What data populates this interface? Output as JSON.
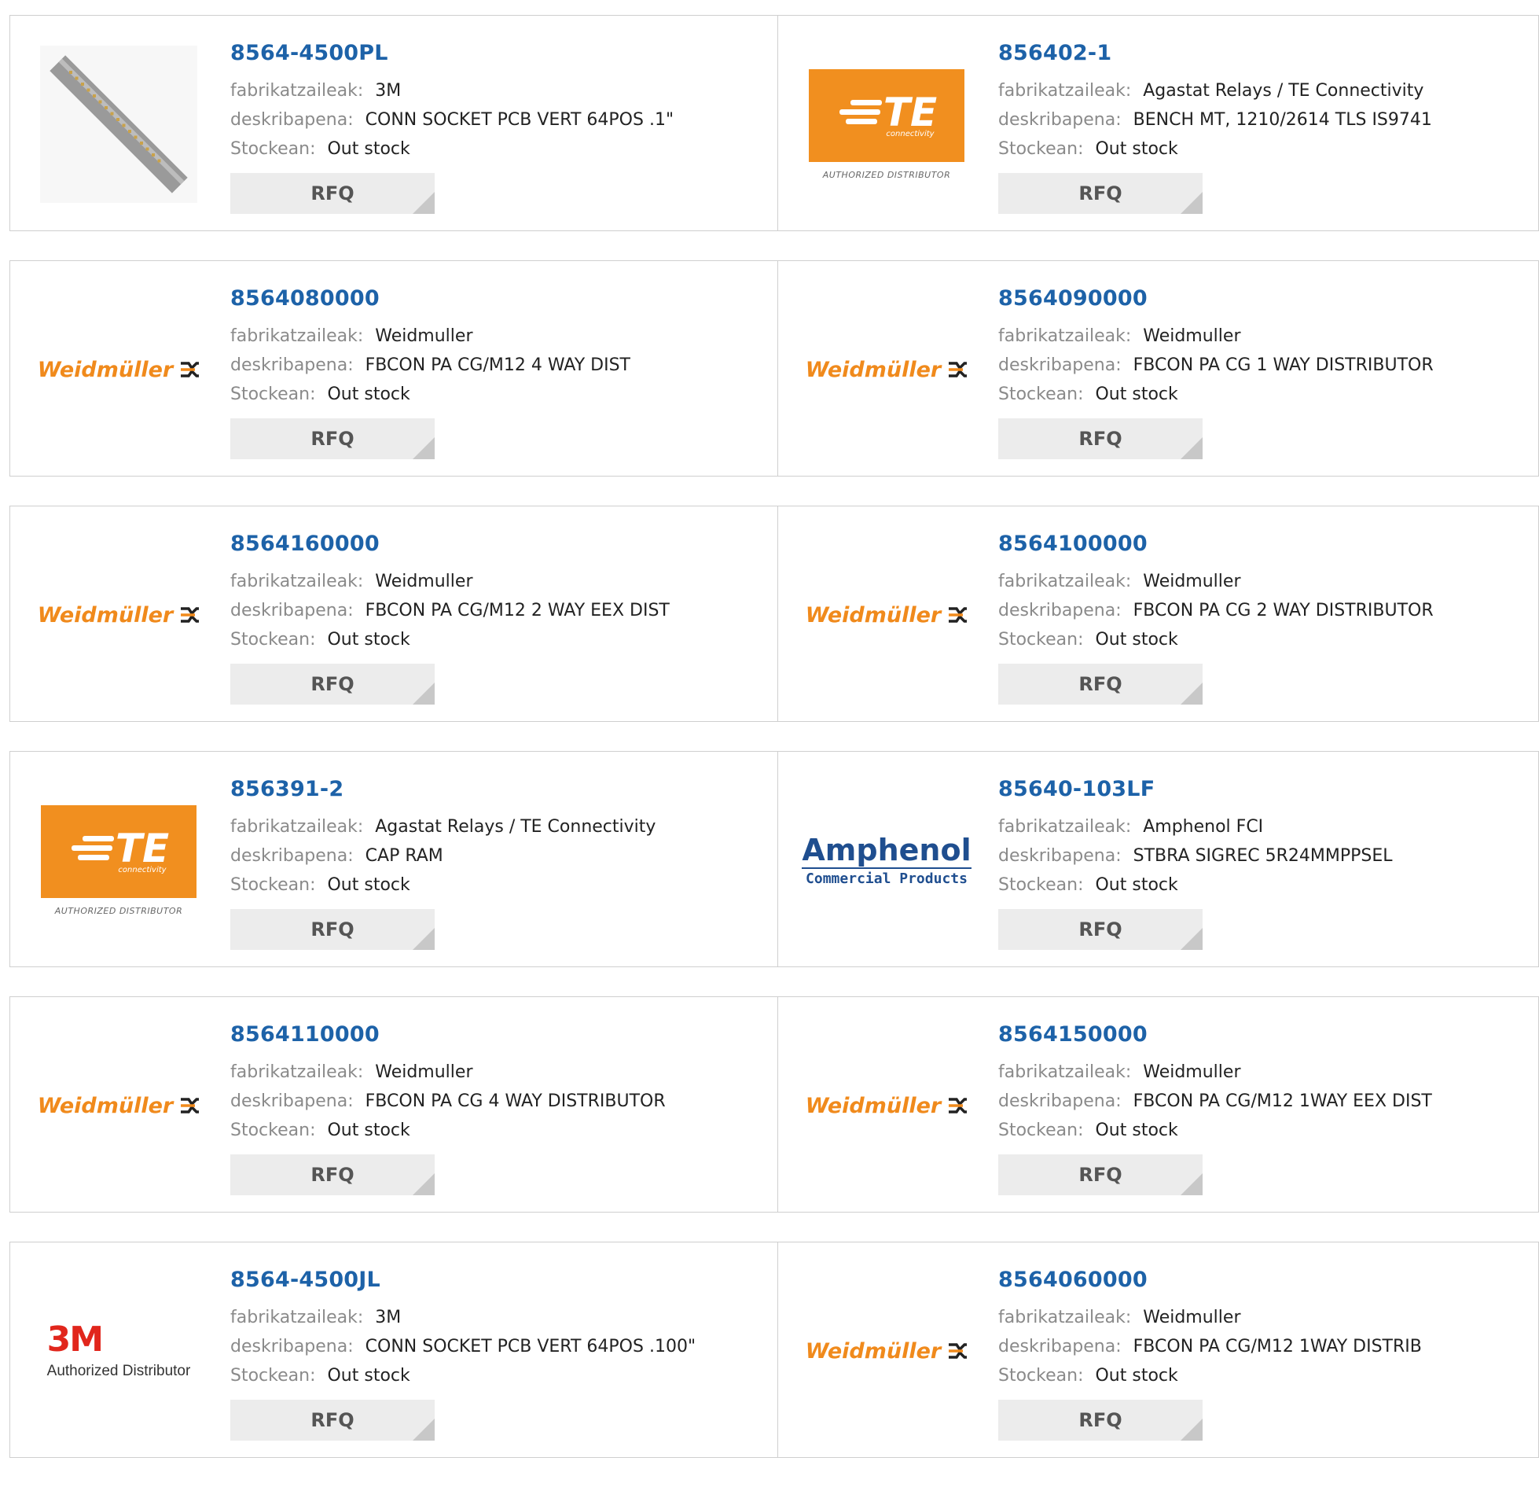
{
  "labels": {
    "manufacturer": "fabrikatzaileak:",
    "description": "deskribapena:",
    "stock": "Stockean:",
    "rfq": "RFQ"
  },
  "logos": {
    "weidmuller": "Weidmüller",
    "te": "TE",
    "te_sub": "connectivity",
    "te_authorized": "AUTHORIZED DISTRIBUTOR",
    "amphenol": "Amphenol",
    "amphenol_sub": "Commercial Products",
    "mmm": "3M",
    "mmm_sub": "Authorized Distributor"
  },
  "colors": {
    "link": "#1d62a8",
    "orange": "#f18f1f",
    "amphenol": "#1f4e8f",
    "mmm": "#e1261c"
  },
  "products": [
    {
      "pn": "8564-4500PL",
      "manufacturer": "3M",
      "description": "CONN SOCKET PCB VERT 64POS .1\"",
      "stock": "Out stock",
      "logo": "socket-image"
    },
    {
      "pn": "856402-1",
      "manufacturer": "Agastat Relays / TE Connectivity",
      "description": "BENCH MT, 1210/2614 TLS IS9741",
      "stock": "Out stock",
      "logo": "te"
    },
    {
      "pn": "8564080000",
      "manufacturer": "Weidmuller",
      "description": "FBCON PA CG/M12 4 WAY DIST",
      "stock": "Out stock",
      "logo": "weidmuller"
    },
    {
      "pn": "8564090000",
      "manufacturer": "Weidmuller",
      "description": "FBCON PA CG 1 WAY DISTRIBUTOR",
      "stock": "Out stock",
      "logo": "weidmuller"
    },
    {
      "pn": "8564160000",
      "manufacturer": "Weidmuller",
      "description": "FBCON PA CG/M12 2 WAY EEX DIST",
      "stock": "Out stock",
      "logo": "weidmuller"
    },
    {
      "pn": "8564100000",
      "manufacturer": "Weidmuller",
      "description": "FBCON PA CG 2 WAY DISTRIBUTOR",
      "stock": "Out stock",
      "logo": "weidmuller"
    },
    {
      "pn": "856391-2",
      "manufacturer": "Agastat Relays / TE Connectivity",
      "description": "CAP RAM",
      "stock": "Out stock",
      "logo": "te"
    },
    {
      "pn": "85640-103LF",
      "manufacturer": "Amphenol FCI",
      "description": "STBRA SIGREC 5R24MMPPSEL",
      "stock": "Out stock",
      "logo": "amphenol"
    },
    {
      "pn": "8564110000",
      "manufacturer": "Weidmuller",
      "description": "FBCON PA CG 4 WAY DISTRIBUTOR",
      "stock": "Out stock",
      "logo": "weidmuller"
    },
    {
      "pn": "8564150000",
      "manufacturer": "Weidmuller",
      "description": "FBCON PA CG/M12 1WAY EEX DIST",
      "stock": "Out stock",
      "logo": "weidmuller"
    },
    {
      "pn": "8564-4500JL",
      "manufacturer": "3M",
      "description": "CONN SOCKET PCB VERT 64POS .100\"",
      "stock": "Out stock",
      "logo": "3m"
    },
    {
      "pn": "8564060000",
      "manufacturer": "Weidmuller",
      "description": "FBCON PA CG/M12 1WAY DISTRIB",
      "stock": "Out stock",
      "logo": "weidmuller"
    }
  ]
}
